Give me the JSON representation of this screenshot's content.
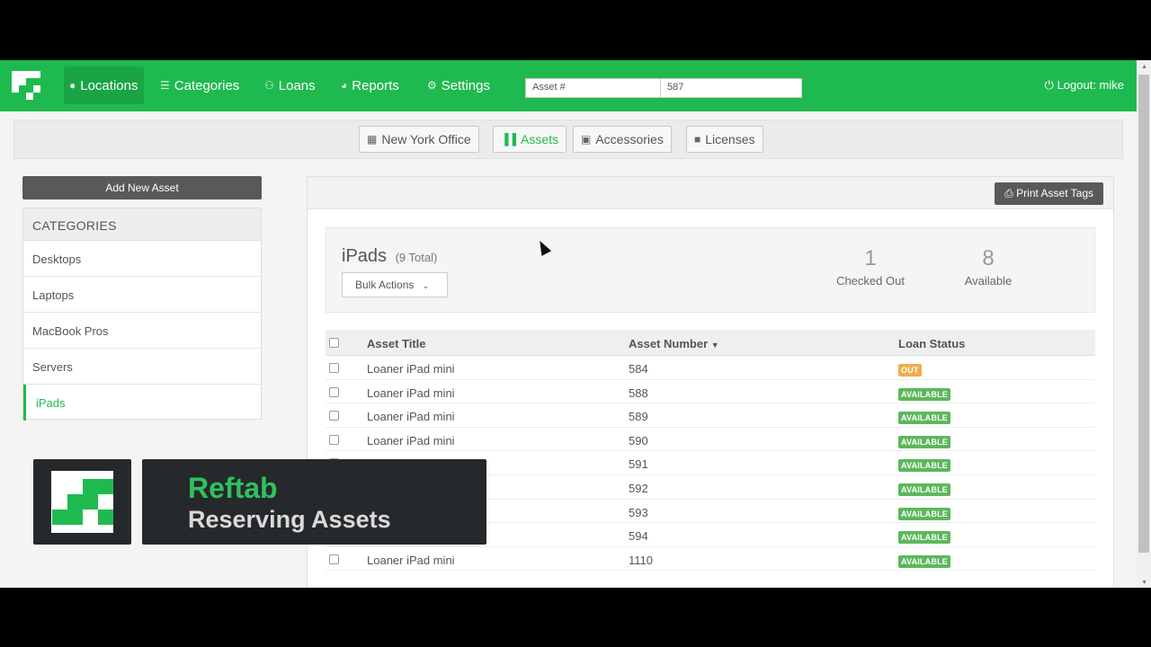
{
  "nav": {
    "items": [
      {
        "label": "Locations",
        "icon": "map-pin-icon"
      },
      {
        "label": "Categories",
        "icon": "list-icon"
      },
      {
        "label": "Loans",
        "icon": "users-icon"
      },
      {
        "label": "Reports",
        "icon": "pie-chart-icon"
      },
      {
        "label": "Settings",
        "icon": "gears-icon"
      }
    ],
    "search_type": "Asset #",
    "search_value": "587",
    "logout": "Logout: mike"
  },
  "tabs": [
    {
      "label": "New York Office",
      "icon": "building-icon"
    },
    {
      "label": "Assets",
      "icon": "barcode-icon"
    },
    {
      "label": "Accessories",
      "icon": "cubes-icon"
    },
    {
      "label": "Licenses",
      "icon": "archive-icon"
    }
  ],
  "sidebar": {
    "add_button": "Add New Asset",
    "heading": "CATEGORIES",
    "items": [
      "Desktops",
      "Laptops",
      "MacBook Pros",
      "Servers",
      "iPads"
    ]
  },
  "main": {
    "print_button": "Print Asset Tags",
    "title": "iPads",
    "total": "(9 Total)",
    "bulk_actions": "Bulk Actions",
    "stats": {
      "checked_out_count": "1",
      "checked_out_label": "Checked Out",
      "available_count": "8",
      "available_label": "Available"
    },
    "table": {
      "headers": [
        "Asset Title",
        "Asset Number",
        "Loan Status"
      ],
      "rows": [
        {
          "title": "Loaner iPad mini",
          "number": "584",
          "status": "OUT"
        },
        {
          "title": "Loaner iPad mini",
          "number": "588",
          "status": "AVAILABLE"
        },
        {
          "title": "Loaner iPad mini",
          "number": "589",
          "status": "AVAILABLE"
        },
        {
          "title": "Loaner iPad mini",
          "number": "590",
          "status": "AVAILABLE"
        },
        {
          "title": "",
          "number": "591",
          "status": "AVAILABLE"
        },
        {
          "title": "",
          "number": "592",
          "status": "AVAILABLE"
        },
        {
          "title": "",
          "number": "593",
          "status": "AVAILABLE"
        },
        {
          "title": "",
          "number": "594",
          "status": "AVAILABLE"
        },
        {
          "title": "Loaner iPad mini",
          "number": "1110",
          "status": "AVAILABLE"
        }
      ]
    }
  },
  "overlay": {
    "title": "Reftab",
    "subtitle": "Reserving Assets"
  },
  "colors": {
    "brand": "#1fba4f",
    "out": "#f0ad4e",
    "available": "#5cb85c"
  }
}
